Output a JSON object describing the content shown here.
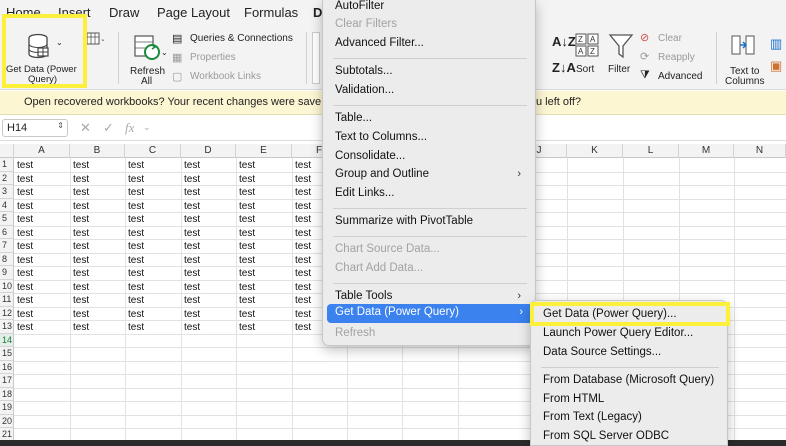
{
  "tabs": [
    {
      "label": "Home"
    },
    {
      "label": "Insert"
    },
    {
      "label": "Draw"
    },
    {
      "label": "Page Layout"
    },
    {
      "label": "Formulas"
    },
    {
      "label": "D"
    }
  ],
  "ribbon": {
    "get_data_line1": "Get Data (Power",
    "get_data_line2": "Query)",
    "refresh_line1": "Refresh",
    "refresh_line2": "All",
    "queries_connections": "Queries & Connections",
    "properties": "Properties",
    "workbook_links": "Workbook Links",
    "sort": "Sort",
    "filter": "Filter",
    "clear": "Clear",
    "reapply": "Reapply",
    "advanced": "Advanced",
    "text_to_columns_line1": "Text to",
    "text_to_columns_line2": "Columns"
  },
  "message_bar": {
    "left": "Open recovered workbooks?  Your recent changes were save",
    "right": "u left off?"
  },
  "formula_bar": {
    "name_box": "H14",
    "fx": "fx"
  },
  "grid": {
    "columns": [
      "A",
      "B",
      "C",
      "D",
      "E",
      "F",
      "J",
      "K",
      "L",
      "M",
      "N"
    ],
    "rows": [
      "1",
      "2",
      "3",
      "4",
      "5",
      "6",
      "7",
      "8",
      "9",
      "10",
      "11",
      "12",
      "13",
      "14",
      "15",
      "16",
      "17",
      "18",
      "19",
      "20",
      "21"
    ],
    "active_row": "14",
    "cell_text": "test"
  },
  "data_menu": {
    "items": [
      {
        "label": "AutoFilter",
        "disabled": false
      },
      {
        "label": "Clear Filters",
        "disabled": true
      },
      {
        "label": "Advanced Filter...",
        "disabled": false
      },
      {
        "label": "Subtotals...",
        "disabled": false
      },
      {
        "label": "Validation...",
        "disabled": false
      },
      {
        "label": "Table...",
        "disabled": false
      },
      {
        "label": "Text to Columns...",
        "disabled": false
      },
      {
        "label": "Consolidate...",
        "disabled": false
      },
      {
        "label": "Group and Outline",
        "disabled": false
      },
      {
        "label": "Edit Links...",
        "disabled": false
      },
      {
        "label": "Summarize with PivotTable",
        "disabled": false
      },
      {
        "label": "Chart Source Data...",
        "disabled": true
      },
      {
        "label": "Chart Add Data...",
        "disabled": true
      },
      {
        "label": "Table Tools",
        "disabled": false
      },
      {
        "label": "Get Data (Power Query)",
        "disabled": false
      },
      {
        "label": "Refresh",
        "disabled": true
      }
    ],
    "arrow": "›"
  },
  "submenu": {
    "items": [
      {
        "label": "Get Data (Power Query)..."
      },
      {
        "label": "Launch Power Query Editor..."
      },
      {
        "label": "Data Source Settings..."
      },
      {
        "label": "From Database (Microsoft Query)"
      },
      {
        "label": "From HTML"
      },
      {
        "label": "From Text (Legacy)"
      },
      {
        "label": "From SQL Server ODBC"
      }
    ]
  },
  "colors": {
    "menu_highlight": "#3b82ee",
    "callout_yellow": "#fdf03a",
    "excel_green": "#1a7a3c"
  }
}
